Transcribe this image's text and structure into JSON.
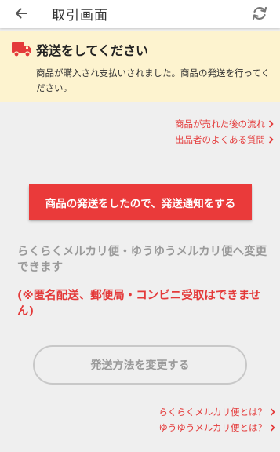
{
  "header": {
    "title": "取引画面",
    "back_icon": "arrow-left-icon",
    "refresh_icon": "refresh-icon"
  },
  "notice": {
    "icon": "truck-icon",
    "heading": "発送をしてください",
    "body": "商品が購入され支払いされました。商品の発送を行ってください。"
  },
  "help_links": [
    {
      "label": "商品が売れた後の流れ"
    },
    {
      "label": "出品者のよくある質問"
    }
  ],
  "cta": {
    "label": "商品の発送をしたので、発送通知をする"
  },
  "info_text": "らくらくメルカリ便・ゆうゆうメルカリ便へ変更できます",
  "warning_text": "(※匿名配送、郵便局・コンビニ受取はできません)",
  "change_button": {
    "label": "発送方法を変更する"
  },
  "shipping_links": [
    {
      "label": "らくらくメルカリ便とは？"
    },
    {
      "label": "ゆうゆうメルカリ便とは？"
    }
  ],
  "colors": {
    "accent": "#ea3a3a",
    "link": "#e43a3a",
    "notice_bg": "#fdf3cf",
    "page_bg": "#efefef"
  }
}
